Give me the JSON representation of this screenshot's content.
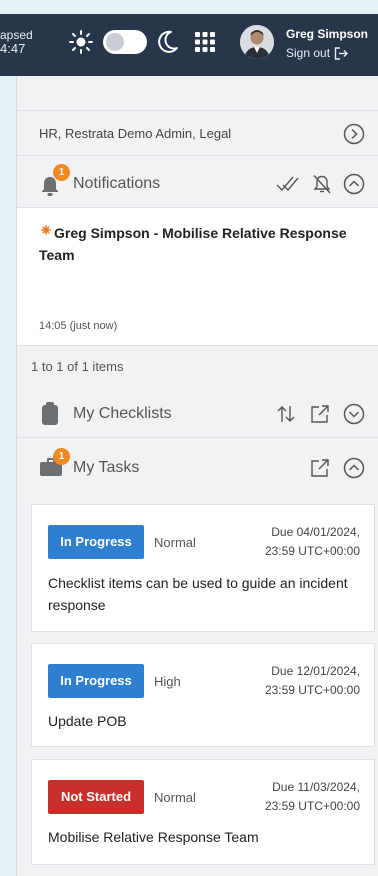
{
  "topbar": {
    "elapsed_label": "apsed",
    "elapsed_time": "4:47",
    "user_name": "Greg Simpson",
    "signout_label": "Sign out"
  },
  "panel": {
    "roles_text": "HR, Restrata Demo Admin, Legal",
    "notifications": {
      "title": "Notifications",
      "badge": "1",
      "items": [
        {
          "title": "Greg Simpson - Mobilise Relative Response Team",
          "time": "14:05 (just now)"
        }
      ],
      "pager": "1 to 1 of 1 items"
    },
    "checklists": {
      "title": "My Checklists"
    },
    "tasks": {
      "title": "My Tasks",
      "badge": "1",
      "items": [
        {
          "status": "In Progress",
          "status_color": "#2f7fd0",
          "priority": "Normal",
          "due_line1": "Due 04/01/2024,",
          "due_line2": "23:59 UTC+00:00",
          "title": "Checklist items can be used to guide an incident response"
        },
        {
          "status": "In Progress",
          "status_color": "#2f7fd0",
          "priority": "High",
          "due_line1": "Due 12/01/2024,",
          "due_line2": "23:59 UTC+00:00",
          "title": "Update POB"
        },
        {
          "status": "Not Started",
          "status_color": "#c9302c",
          "priority": "Normal",
          "due_line1": "Due 11/03/2024,",
          "due_line2": "23:59 UTC+00:00",
          "title": "Mobilise Relative Response Team"
        }
      ]
    }
  },
  "colors": {
    "topbar_bg": "#27364a",
    "badge": "#f08a24",
    "in_progress": "#2f7fd0",
    "not_started": "#c9302c"
  },
  "icons": [
    "sun-icon",
    "moon-icon",
    "apps-grid-icon",
    "sign-out-icon",
    "chevron-right-circle-icon",
    "bell-icon",
    "mark-all-read-icon",
    "mute-bell-icon",
    "chevron-up-circle-icon",
    "clipboard-icon",
    "sort-icon",
    "external-link-icon",
    "chevron-down-circle-icon",
    "briefcase-icon"
  ]
}
